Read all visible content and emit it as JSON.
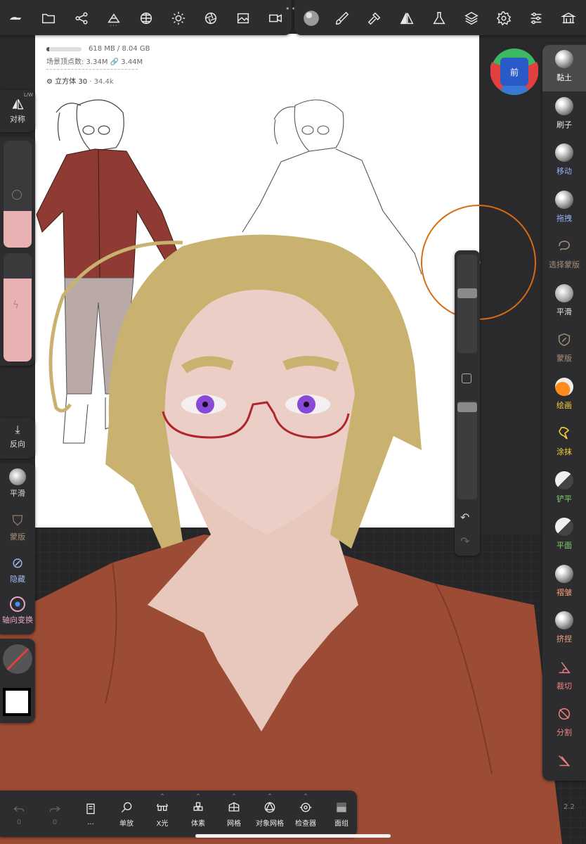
{
  "top_left_tools": [
    {
      "name": "menu-icon",
      "more": ""
    },
    {
      "name": "folder-icon",
      "more": ""
    },
    {
      "name": "scene-graph-icon",
      "more": ""
    },
    {
      "name": "primitives-icon",
      "more": "..."
    },
    {
      "name": "material-sphere-icon",
      "more": ""
    },
    {
      "name": "light-icon",
      "more": ""
    },
    {
      "name": "camera-aperture-icon",
      "more": ""
    },
    {
      "name": "image-icon",
      "more": ""
    },
    {
      "name": "video-icon",
      "more": ""
    }
  ],
  "top_right_tools": [
    {
      "name": "material-ball-icon"
    },
    {
      "name": "paint-brush-icon"
    },
    {
      "name": "hammer-icon"
    },
    {
      "name": "symmetry-icon"
    },
    {
      "name": "flask-icon"
    },
    {
      "name": "layers-icon"
    },
    {
      "name": "settings-gear-icon"
    },
    {
      "name": "sliders-icon"
    },
    {
      "name": "store-icon"
    }
  ],
  "stats": {
    "memory": "618 MB / 8.04 GB",
    "vertices_label": "场景顶点数: 3.34M",
    "links": "3.44M",
    "object": "立方体 30",
    "object_count": "· 34.4k"
  },
  "gizmo": {
    "label": "前"
  },
  "left_panel": {
    "symmetry_label": "对称",
    "symmetry_corner": "L/W",
    "invert_label": "反向",
    "tools": [
      {
        "label": "平滑",
        "color": "#e8e8e8"
      },
      {
        "label": "蒙版",
        "color": "#a48f78"
      },
      {
        "label": "隐藏",
        "color": "#9ab8e8"
      },
      {
        "label": "轴向变换",
        "color": "#e8a8c8"
      }
    ]
  },
  "colors": {
    "radius_fill": "#e8b2b3",
    "intensity_fill": "#e8b2b3",
    "accent_orange": "#d96b10",
    "swatch": "#ffffff"
  },
  "right_tools": [
    {
      "label": "黏土",
      "color": "#ffffff",
      "icon": "sphere",
      "active": true
    },
    {
      "label": "刷子",
      "color": "#e8e8e8",
      "icon": "sphere"
    },
    {
      "label": "移动",
      "color": "#9ab0f0",
      "icon": "sphere"
    },
    {
      "label": "拖拽",
      "color": "#9ab0f0",
      "icon": "sphere"
    },
    {
      "label": "选择蒙版",
      "color": "#a48f78",
      "icon": "lasso"
    },
    {
      "label": "平滑",
      "color": "#e8e8e8",
      "icon": "noise"
    },
    {
      "label": "蒙版",
      "color": "#a48f78",
      "icon": "shield"
    },
    {
      "label": "绘画",
      "color": "#f4d03a",
      "icon": "orange-sphere"
    },
    {
      "label": "涂抹",
      "color": "#f4d03a",
      "icon": "smudge"
    },
    {
      "label": "铲平",
      "color": "#7fd36c",
      "icon": "half-sphere"
    },
    {
      "label": "平面",
      "color": "#7fd36c",
      "icon": "half-sphere"
    },
    {
      "label": "褶皱",
      "color": "#f4a07a",
      "icon": "sphere"
    },
    {
      "label": "挤捏",
      "color": "#f4a07a",
      "icon": "sphere"
    },
    {
      "label": "裁切",
      "color": "#f08080",
      "icon": "cut"
    },
    {
      "label": "分割",
      "color": "#f08080",
      "icon": "split"
    },
    {
      "label": "",
      "color": "#f08080",
      "icon": "trim"
    }
  ],
  "bottom_tools": [
    {
      "label": "0",
      "name": "undo",
      "dim": true
    },
    {
      "label": "0",
      "name": "redo",
      "dim": true
    },
    {
      "label": "...",
      "name": "book"
    },
    {
      "label": "单放",
      "name": "search"
    },
    {
      "label": "X光",
      "name": "xray"
    },
    {
      "label": "体素",
      "name": "voxel"
    },
    {
      "label": "网格",
      "name": "grid"
    },
    {
      "label": "对象网格",
      "name": "object-grid"
    },
    {
      "label": "检查器",
      "name": "inspector"
    },
    {
      "label": "面组",
      "name": "facegroup"
    }
  ],
  "version_label": "2.2"
}
